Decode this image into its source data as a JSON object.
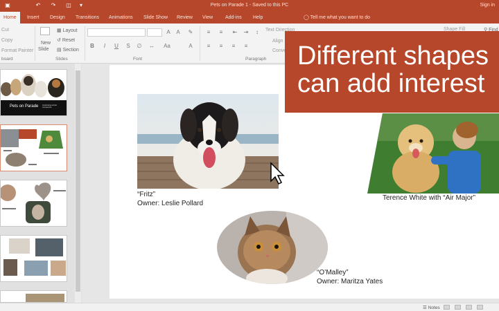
{
  "titlebar": {
    "doc_title": "Pets on Parade 1  -  Saved to this PC",
    "signin": "Sign in"
  },
  "tabs": [
    "Home",
    "Insert",
    "Design",
    "Transitions",
    "Animations",
    "Slide Show",
    "Review",
    "View",
    "Add-ins",
    "Help"
  ],
  "tell_me": "Tell me what you want to do",
  "ribbon": {
    "cut": "Cut",
    "copy": "Copy",
    "format_painter": "Format Painter",
    "clipboard_group": "board",
    "new_slide": "New",
    "new_slide_2": "Slide",
    "layout": "Layout",
    "reset": "Reset",
    "section": "Section",
    "slides_group": "Slides",
    "font_group": "Font",
    "paragraph_group": "Paragraph",
    "text_direction": "Text Direction",
    "align_text": "Align",
    "convert": "Conve",
    "shape_fill": "Shape Fill",
    "find": "Find"
  },
  "thumbnail_one": {
    "title": "Pets on Parade",
    "subtitle": "Celebrating animal companions"
  },
  "slide": {
    "callout_line1": "Different shapes",
    "callout_line2": "can add interest",
    "caption_fritz_1": "“Fritz”",
    "caption_fritz_2": "Owner: Leslie Pollard",
    "caption_terence": "Terence White with “Air Major”",
    "caption_omalley_1": "“O’Malley”",
    "caption_omalley_2": "Owner: Maritza Yates"
  },
  "status": {
    "notes": "Notes"
  },
  "colors": {
    "accent": "#b7472a",
    "ribbon": "#f3f3f3"
  }
}
